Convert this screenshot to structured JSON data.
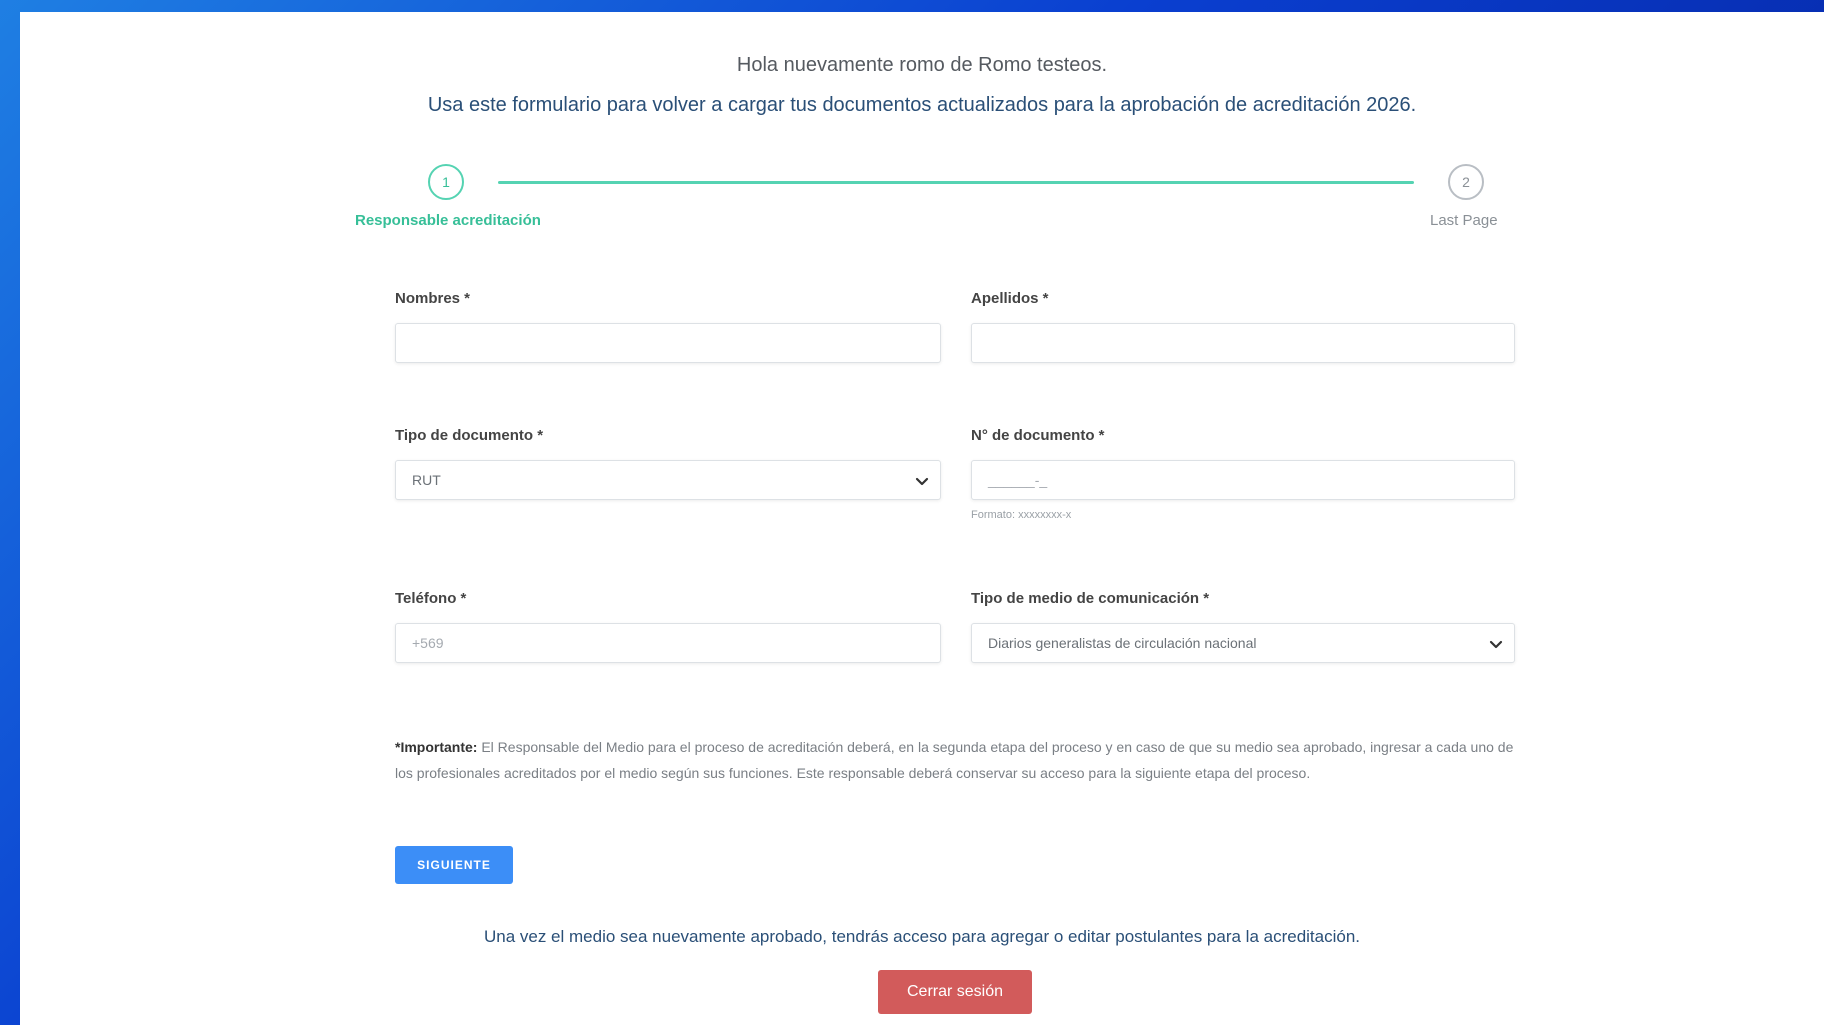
{
  "header": {
    "greeting": "Hola nuevamente romo de Romo testeos.",
    "intro": "Usa este formulario para volver a cargar tus documentos actualizados para la aprobación de acreditación 2026."
  },
  "stepper": {
    "steps": [
      {
        "number": "1",
        "label": "Responsable acreditación",
        "state": "active"
      },
      {
        "number": "2",
        "label": "Last Page",
        "state": "pending"
      }
    ],
    "progress_color": "#55d3b2"
  },
  "form": {
    "nombres": {
      "label": "Nombres *",
      "value": ""
    },
    "apellidos": {
      "label": "Apellidos *",
      "value": ""
    },
    "tipo_documento": {
      "label": "Tipo de documento *",
      "selected": "RUT"
    },
    "numero_documento": {
      "label": "N° de documento *",
      "placeholder": "______-_",
      "hint": "Formato: xxxxxxxx-x"
    },
    "telefono": {
      "label": "Teléfono *",
      "placeholder": "+569"
    },
    "tipo_medio": {
      "label": "Tipo de medio de comunicación *",
      "selected": "Diarios generalistas de circulación nacional"
    }
  },
  "important": {
    "prefix": "*Importante:",
    "text": " El Responsable del Medio para el proceso de acreditación deberá, en la segunda etapa del proceso y en caso de que su medio sea aprobado, ingresar a cada uno de los profesionales acreditados por el medio según sus funciones. Este responsable deberá conservar su acceso para la siguiente etapa del proceso."
  },
  "actions": {
    "next_label": "SIGUIENTE",
    "note": "Una vez el medio sea nuevamente aprobado, tendrás acceso para agregar o editar postulantes para la acreditación.",
    "logout_label": "Cerrar sesión"
  },
  "colors": {
    "primary_button": "#3c8ef7",
    "logout_button": "#d25b5b",
    "accent_green": "#37bf98"
  }
}
